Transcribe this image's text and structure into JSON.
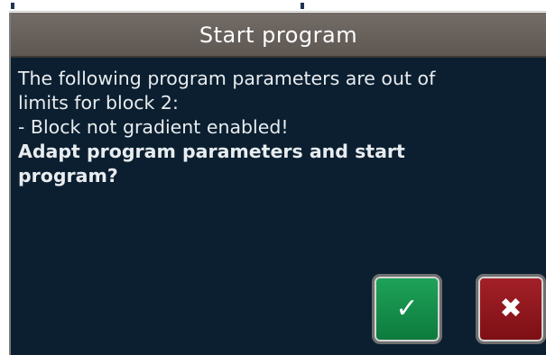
{
  "dialog": {
    "title": "Start program",
    "message_lines": [
      "The following program parameters are out of",
      "limits for block 2:",
      "- Block not gradient enabled!"
    ],
    "question_lines": [
      "Adapt program parameters and start",
      "program?"
    ]
  },
  "buttons": {
    "confirm_icon": "check-icon",
    "cancel_icon": "close-icon",
    "confirm_glyph": "✓",
    "cancel_glyph": "✖"
  },
  "colors": {
    "background": "#0b1f30",
    "title_bar": "#6a635e",
    "confirm": "#1b9a52",
    "cancel": "#9a1b22"
  }
}
